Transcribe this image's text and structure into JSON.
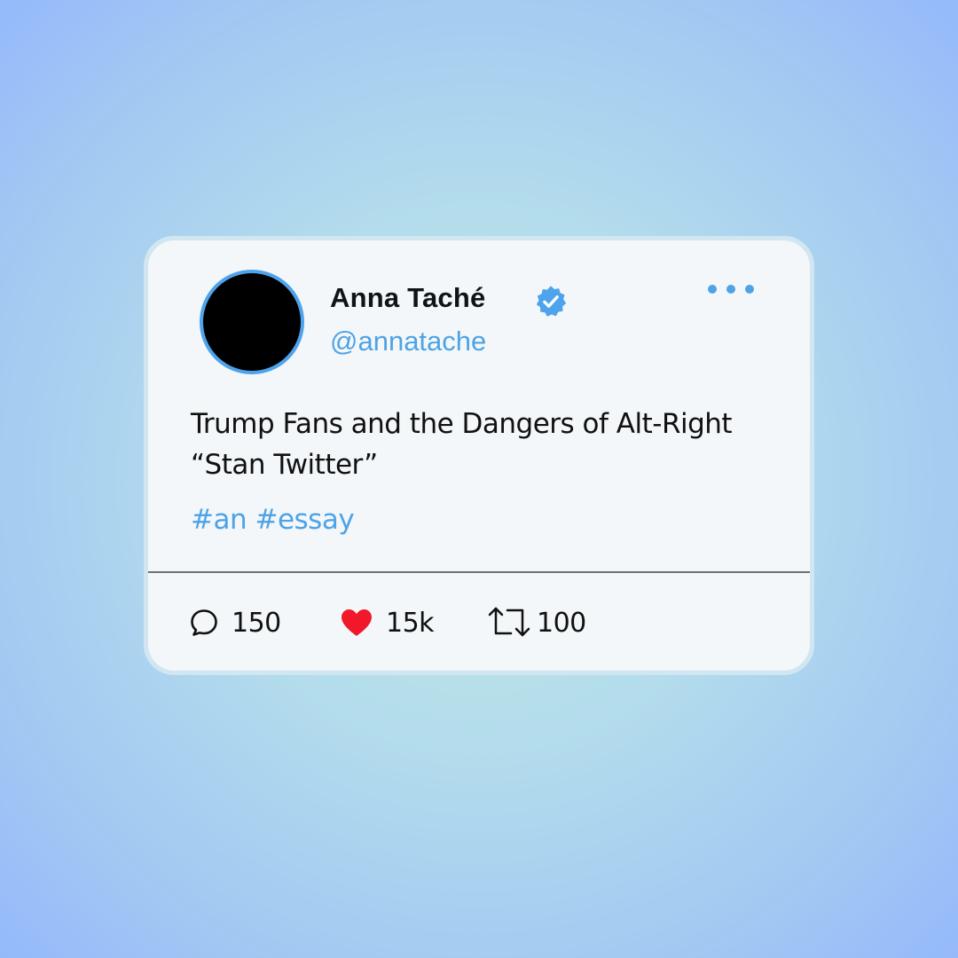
{
  "post": {
    "author": {
      "name": "Anna Taché",
      "handle": "@annatache",
      "verified": true
    },
    "text": "Trump Fans and the Dangers of Alt-Right “Stan Twitter”",
    "hashtags": [
      "#an",
      "#essay"
    ],
    "stats": {
      "replies": "150",
      "likes": "15k",
      "retweets": "100"
    }
  },
  "icons": {
    "more": "more-options-icon",
    "verified": "verified-badge-icon",
    "reply": "reply-bubble-icon",
    "like": "heart-icon",
    "retweet": "retweet-icon"
  },
  "colors": {
    "accent": "#4ea3e6",
    "like": "#f0182a",
    "text": "#111111",
    "card": "#f3f7f9",
    "divider": "#6f6f73"
  }
}
